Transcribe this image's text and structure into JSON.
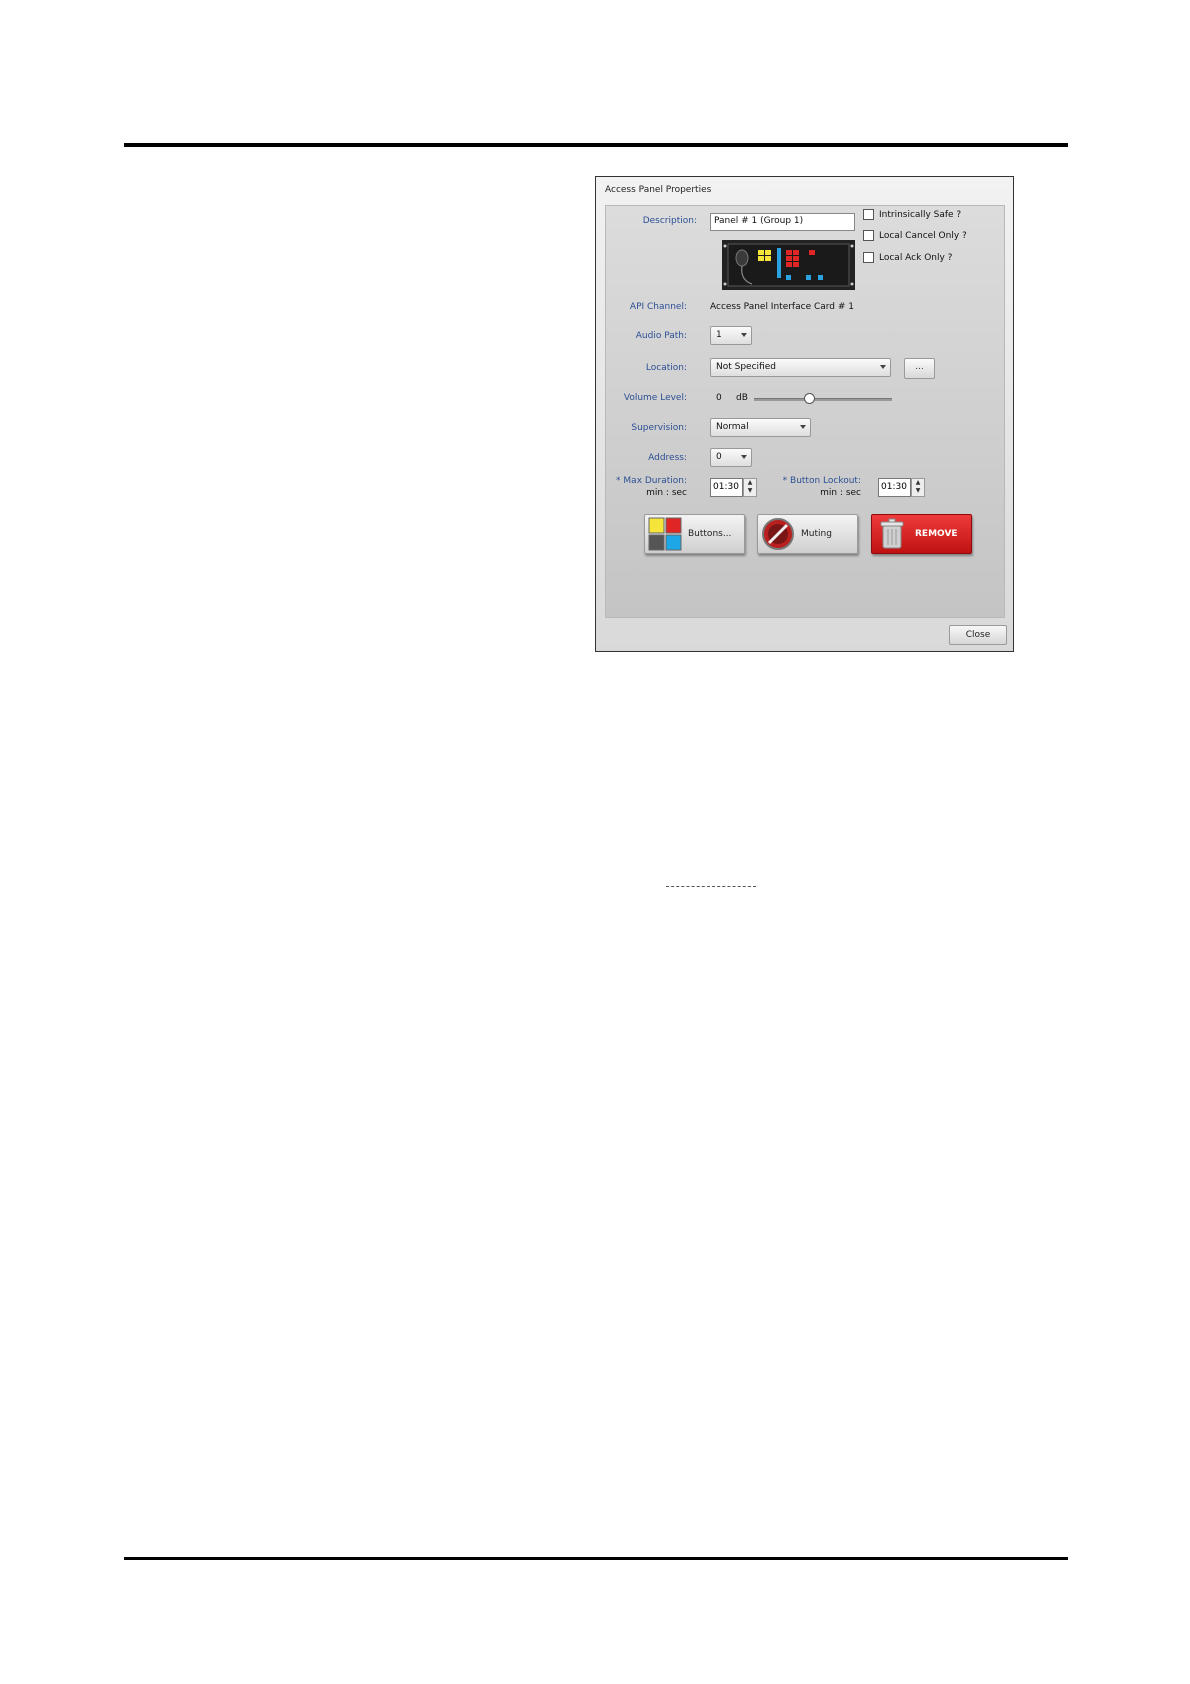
{
  "dialog": {
    "title": "Access Panel Properties",
    "description_label": "Description:",
    "description_value": "Panel # 1 (Group 1)",
    "checkboxes": [
      {
        "label": "Intrinsically Safe ?",
        "checked": false
      },
      {
        "label": "Local Cancel Only ?",
        "checked": false
      },
      {
        "label": "Local Ack Only ?",
        "checked": false
      }
    ],
    "api_channel_label": "API Channel:",
    "api_channel_value": "Access Panel Interface Card # 1",
    "audio_path_label": "Audio Path:",
    "audio_path_value": "1",
    "location_label": "Location:",
    "location_value": "Not Specified",
    "location_browse": "...",
    "volume_label": "Volume Level:",
    "volume_value": "0",
    "volume_unit": "dB",
    "volume_fraction": 0.4,
    "supervision_label": "Supervision:",
    "supervision_value": "Normal",
    "address_label": "Address:",
    "address_value": "0",
    "max_duration_label": "* Max Duration:",
    "max_duration_sub": "min : sec",
    "max_duration_value": "01:30",
    "button_lockout_label": "* Button Lockout:",
    "button_lockout_sub": "min : sec",
    "button_lockout_value": "01:30",
    "buttons_label": "Buttons...",
    "muting_label": "Muting",
    "remove_label": "REMOVE",
    "close_label": "Close"
  },
  "colors": {
    "label_blue": "#2c4f94",
    "remove_red": "#d42020"
  },
  "icons": [
    "panel-device-icon",
    "button-grid-icon",
    "mute-icon",
    "trash-icon"
  ]
}
